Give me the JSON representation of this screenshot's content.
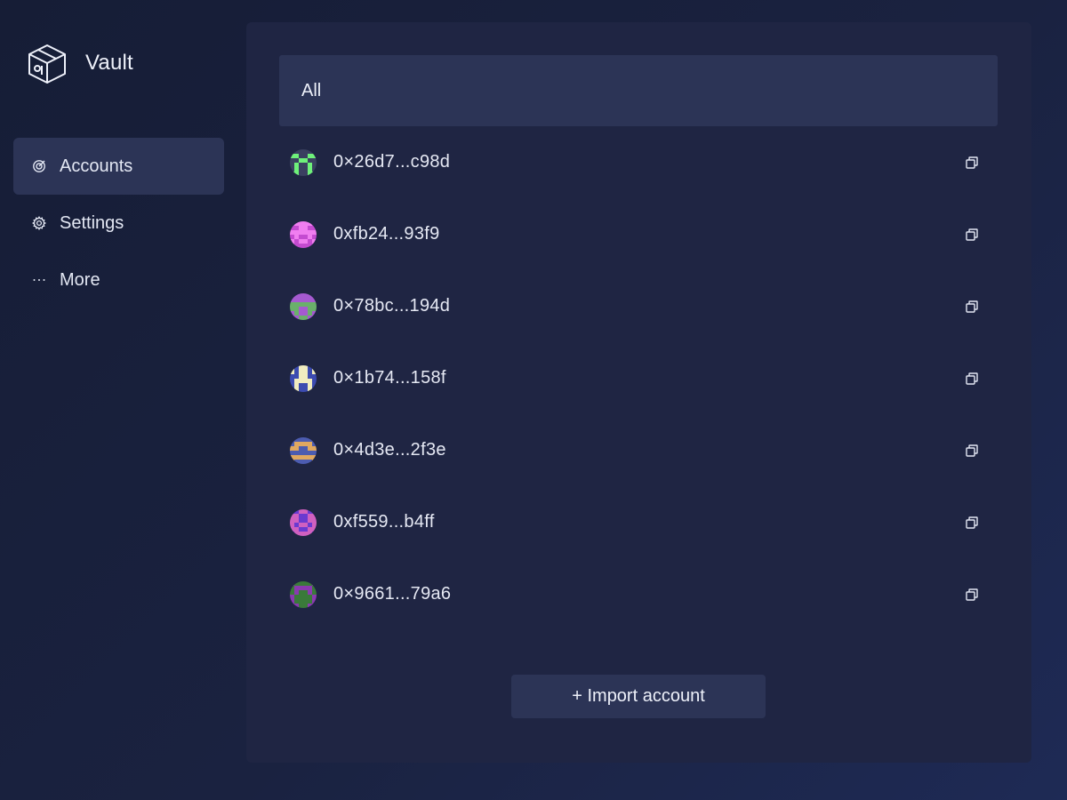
{
  "app": {
    "name": "Vault"
  },
  "sidebar": {
    "items": [
      {
        "label": "Accounts",
        "icon": "target-icon",
        "active": true
      },
      {
        "label": "Settings",
        "icon": "gear-icon",
        "active": false
      },
      {
        "label": "More",
        "icon": "dots-icon",
        "active": false
      }
    ]
  },
  "filter": {
    "label": "All"
  },
  "accounts": [
    {
      "address": "0×26d7...c98d",
      "avatar_colors": [
        "#3a4060",
        "#6ef07a"
      ]
    },
    {
      "address": "0xfb24...93f9",
      "avatar_colors": [
        "#c44bd0",
        "#f07ef0"
      ]
    },
    {
      "address": "0×78bc...194d",
      "avatar_colors": [
        "#a55ad0",
        "#6ab06a"
      ]
    },
    {
      "address": "0×1b74...158f",
      "avatar_colors": [
        "#3c4bb0",
        "#f0ecc0"
      ]
    },
    {
      "address": "0×4d3e...2f3e",
      "avatar_colors": [
        "#4c5cb0",
        "#e0a860"
      ]
    },
    {
      "address": "0xf559...b4ff",
      "avatar_colors": [
        "#6a3ad0",
        "#d060c0"
      ]
    },
    {
      "address": "0×9661...79a6",
      "avatar_colors": [
        "#3a7a3a",
        "#8a3ab0"
      ]
    }
  ],
  "import_button": {
    "label": "+ Import account"
  }
}
